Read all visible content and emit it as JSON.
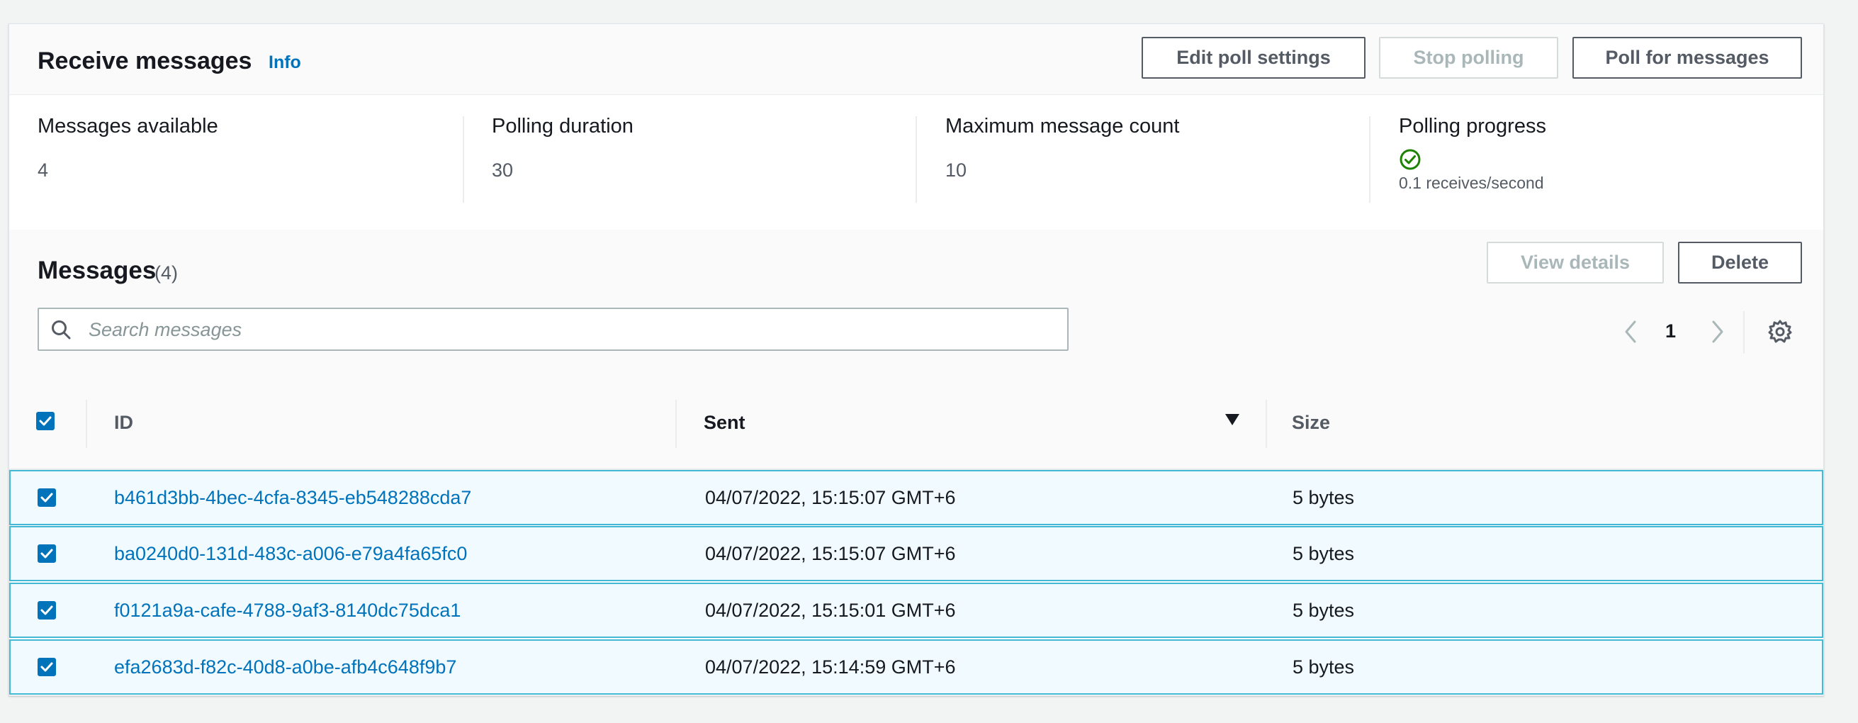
{
  "header": {
    "title": "Receive messages",
    "info_label": "Info",
    "buttons": {
      "edit_poll": "Edit poll settings",
      "stop_polling": "Stop polling",
      "poll_for_messages": "Poll for messages"
    }
  },
  "stats": {
    "messages_available": {
      "label": "Messages available",
      "value": "4"
    },
    "polling_duration": {
      "label": "Polling duration",
      "value": "30"
    },
    "max_message_count": {
      "label": "Maximum message count",
      "value": "10"
    },
    "polling_progress": {
      "label": "Polling progress",
      "status_icon": "check-circle-icon",
      "rate": "0.1 receives/second"
    }
  },
  "messages": {
    "title": "Messages",
    "count": "(4)",
    "buttons": {
      "view_details": "View details",
      "delete": "Delete"
    },
    "search_placeholder": "Search messages",
    "page": "1",
    "columns": {
      "id": "ID",
      "sent": "Sent",
      "size": "Size"
    },
    "rows": [
      {
        "id": "b461d3bb-4bec-4cfa-8345-eb548288cda7",
        "sent": "04/07/2022, 15:15:07 GMT+6",
        "size": "5 bytes",
        "selected": true
      },
      {
        "id": "ba0240d0-131d-483c-a006-e79a4fa65fc0",
        "sent": "04/07/2022, 15:15:07 GMT+6",
        "size": "5 bytes",
        "selected": true
      },
      {
        "id": "f0121a9a-cafe-4788-9af3-8140dc75dca1",
        "sent": "04/07/2022, 15:15:01 GMT+6",
        "size": "5 bytes",
        "selected": true
      },
      {
        "id": "efa2683d-f82c-40d8-a0be-afb4c648f9b7",
        "sent": "04/07/2022, 15:14:59 GMT+6",
        "size": "5 bytes",
        "selected": true
      }
    ]
  },
  "colors": {
    "accent": "#0073bb",
    "success": "#1d8102",
    "selected_row_bg": "#f1faff",
    "selected_row_border": "#44b9d6"
  }
}
